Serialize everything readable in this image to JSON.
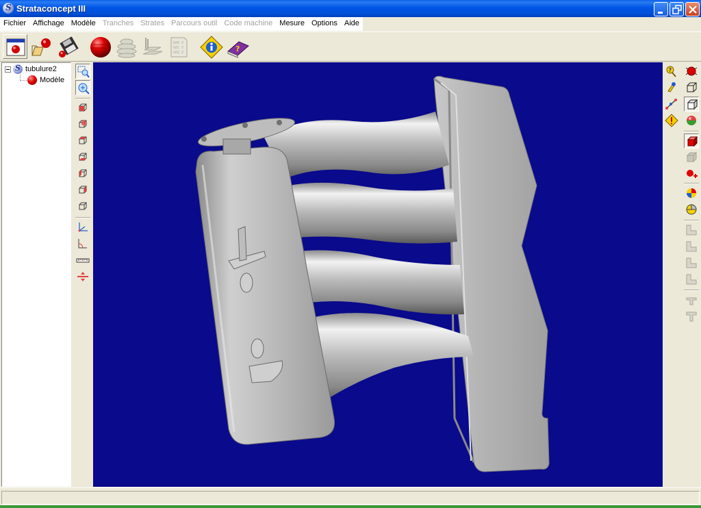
{
  "window": {
    "title": "Strataconcept III"
  },
  "menu": [
    {
      "label": "Fichier",
      "enabled": true
    },
    {
      "label": "Affichage",
      "enabled": true
    },
    {
      "label": "Modèle",
      "enabled": true
    },
    {
      "label": "Tranches",
      "enabled": false
    },
    {
      "label": "Strates",
      "enabled": false
    },
    {
      "label": "Parcours outil",
      "enabled": false
    },
    {
      "label": "Code machine",
      "enabled": false
    },
    {
      "label": "Mesure",
      "enabled": true
    },
    {
      "label": "Options",
      "enabled": true
    },
    {
      "label": "Aide",
      "enabled": true
    }
  ],
  "toolbar": {
    "buttons": [
      {
        "icon": "window-model-icon",
        "enabled": true
      },
      {
        "icon": "open-model-icon",
        "enabled": true
      },
      {
        "icon": "save-model-icon",
        "enabled": true
      },
      {
        "icon": "model-sphere-icon",
        "enabled": true
      },
      {
        "icon": "slices-icon",
        "enabled": false
      },
      {
        "icon": "layers-icon",
        "enabled": false
      },
      {
        "icon": "machine-code-icon",
        "enabled": false
      },
      {
        "icon": "info-icon",
        "enabled": true
      },
      {
        "icon": "help-book-icon",
        "enabled": true
      }
    ]
  },
  "tree": {
    "root": {
      "label": "tubulure2",
      "icon": "strataconcept-icon"
    },
    "children": [
      {
        "label": "Modèle",
        "icon": "model-sphere-icon"
      }
    ]
  },
  "left_tools": [
    "zoom-window-icon",
    "zoom-fit-icon",
    "view-front-icon",
    "view-back-icon",
    "view-top-icon",
    "view-bottom-icon",
    "view-left-icon",
    "view-right-icon",
    "view-iso-icon",
    "axes-icon",
    "angle-icon",
    "ruler-icon",
    "section-icon"
  ],
  "right_tools": [
    "query-icon",
    "pick-icon",
    "measure-point-icon",
    "warning-icon",
    "bug-icon",
    "wireframe-box-icon",
    "solid-box-icon",
    "shading-icon",
    "red-cube-icon",
    "gray-cube-icon",
    "add-point-icon",
    "color-ball-icon",
    "pie-ball-icon",
    "step-1-icon",
    "step-2-icon",
    "step-3-icon",
    "step-4-icon",
    "tool-a-icon",
    "tool-b-icon"
  ],
  "viewport": {
    "background": "#0a0a8c",
    "model_color": "#c8c8c8"
  },
  "status": {
    "text": ""
  }
}
